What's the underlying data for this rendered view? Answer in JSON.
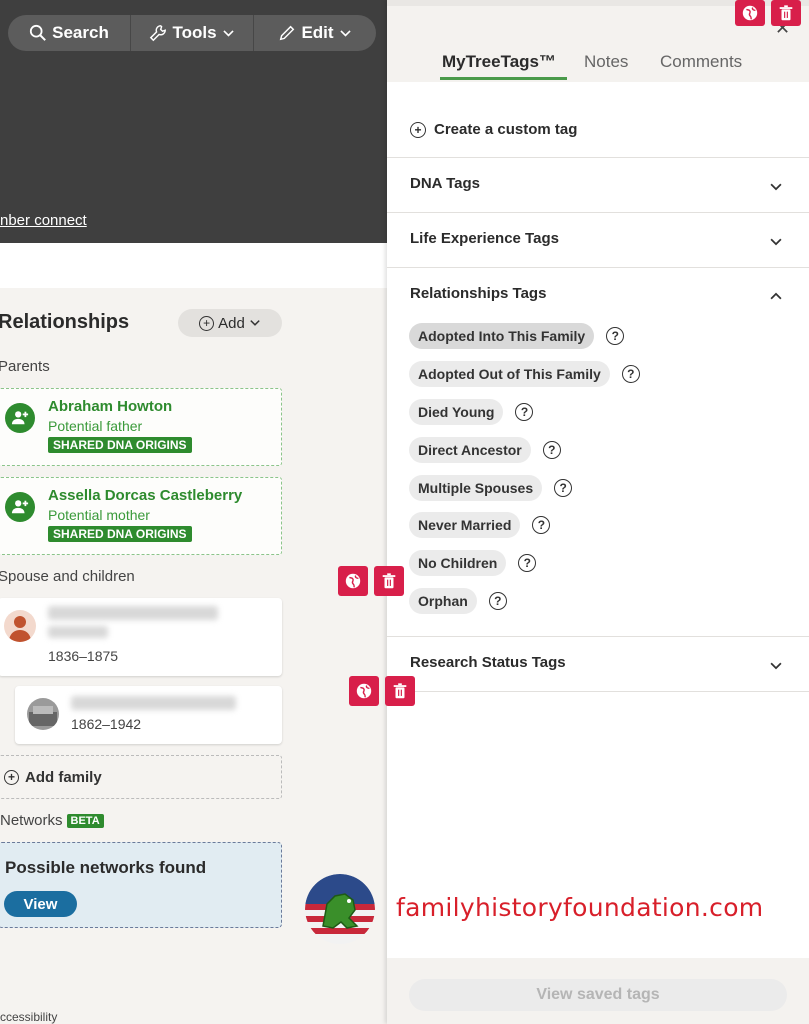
{
  "toolbar": {
    "search_label": "Search",
    "tools_label": "Tools",
    "edit_label": "Edit"
  },
  "member_link": "nber connect",
  "relationships": {
    "title": "Relationships",
    "add_label": "Add",
    "parents_label": "Parents",
    "parents": [
      {
        "name": "Abraham Howton",
        "role": "Potential father",
        "badge": "SHARED DNA ORIGINS"
      },
      {
        "name": "Assella Dorcas Castleberry",
        "role": "Potential mother",
        "badge": "SHARED DNA ORIGINS"
      }
    ],
    "spouse_label": "Spouse and children",
    "spouse_children": [
      {
        "dates": "1836–1875"
      },
      {
        "dates": "1862–1942"
      }
    ],
    "add_family_label": "Add family",
    "networks_label": "Networks",
    "networks_badge": "BETA",
    "networks_card_title": "Possible networks found",
    "networks_view_label": "View",
    "accessibility_label": "ccessibility"
  },
  "panel": {
    "tabs": [
      "MyTreeTags™",
      "Notes",
      "Comments"
    ],
    "active_tab": "MyTreeTags™",
    "create_tag_label": "Create a custom tag",
    "sections": {
      "dna": "DNA Tags",
      "life": "Life Experience Tags",
      "relationships": "Relationships Tags",
      "research": "Research Status Tags"
    },
    "relationship_tags": [
      "Adopted Into This Family",
      "Adopted Out of This Family",
      "Died Young",
      "Direct Ancestor",
      "Multiple Spouses",
      "Never Married",
      "No Children",
      "Orphan"
    ],
    "help_glyph": "?",
    "view_saved_label": "View saved tags"
  },
  "watermark": {
    "brand_text": "familyhistoryfoundation.com"
  },
  "colors": {
    "accent_green": "#2e8b2e",
    "overlay_red": "#d81f4a",
    "brand_red": "#d81f2a",
    "view_blue": "#1b6ea0"
  },
  "icons": [
    "search-icon",
    "wrench-icon",
    "pencil-icon",
    "chevron-down-icon",
    "add-person-icon",
    "globe-icon",
    "trash-icon",
    "plus-circle-icon",
    "help-icon",
    "close-icon"
  ]
}
